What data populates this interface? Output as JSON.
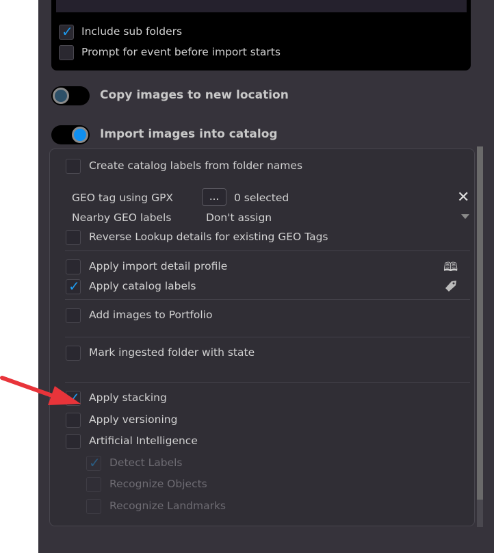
{
  "top_options": [
    {
      "label": "Include sub folders",
      "checked": true
    },
    {
      "label": "Prompt for event before import starts",
      "checked": false
    }
  ],
  "toggles": {
    "copy": {
      "label": "Copy images to new location",
      "on": false
    },
    "import": {
      "label": "Import images into catalog",
      "on": true
    }
  },
  "catalog": {
    "create_labels": {
      "label": "Create catalog labels from folder names",
      "checked": false
    },
    "geo_tag": {
      "label": "GEO tag using GPX",
      "button": "...",
      "value": "0 selected"
    },
    "nearby": {
      "label": "Nearby GEO labels",
      "value": "Don't assign"
    },
    "reverse": {
      "label": "Reverse Lookup details for existing GEO Tags",
      "checked": false
    },
    "detail_profile": {
      "label": "Apply import detail profile",
      "checked": false
    },
    "catalog_labels": {
      "label": "Apply catalog labels",
      "checked": true
    },
    "portfolio": {
      "label": "Add images to Portfolio",
      "checked": false
    },
    "mark_state": {
      "label": "Mark ingested folder with state",
      "checked": false
    },
    "stacking": {
      "label": "Apply stacking",
      "checked": true
    },
    "versioning": {
      "label": "Apply versioning",
      "checked": false
    },
    "ai": {
      "label": "Artificial Intelligence",
      "checked": false
    },
    "detect": {
      "label": "Detect Labels",
      "checked": true
    },
    "objects": {
      "label": "Recognize Objects",
      "checked": false
    },
    "landmarks": {
      "label": "Recognize Landmarks",
      "checked": false
    }
  },
  "colors": {
    "accent": "#1e9bf0",
    "annotation_arrow": "#e8343a"
  }
}
